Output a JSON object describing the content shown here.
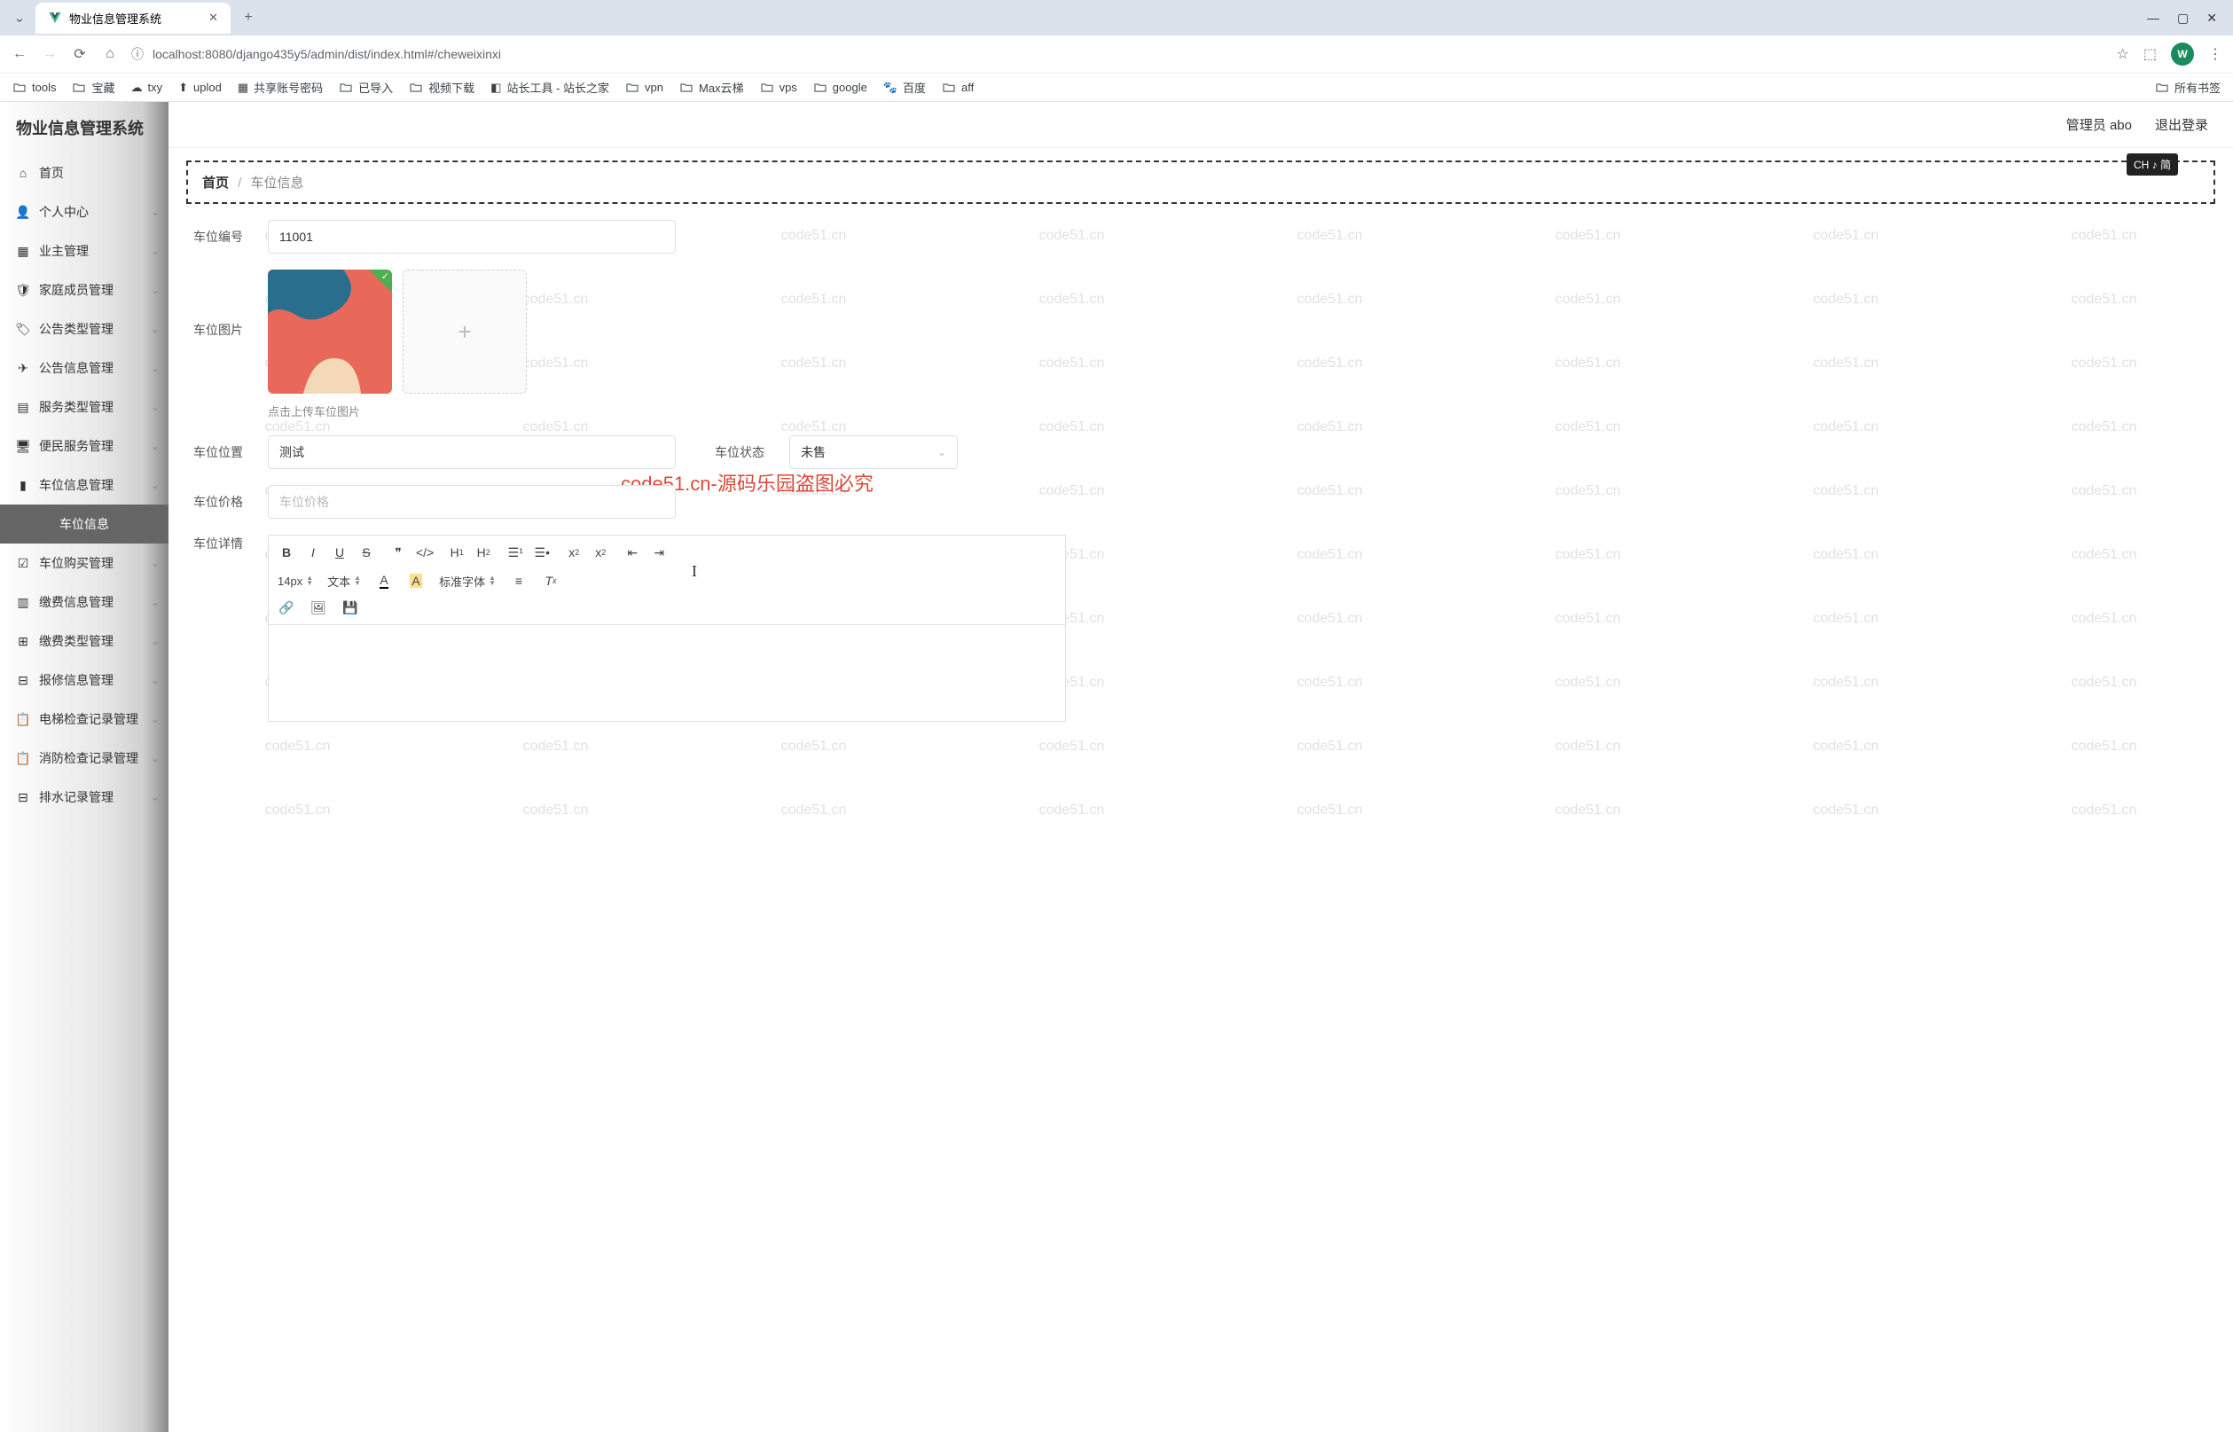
{
  "browser": {
    "tab_title": "物业信息管理系统",
    "url_display": "localhost:8080/django435y5/admin/dist/index.html#/cheweixinxi",
    "bookmarks": [
      "tools",
      "宝藏",
      "txy",
      "uplod",
      "共享账号密码",
      "已导入",
      "视频下载",
      "站长工具 - 站长之家",
      "vpn",
      "Max云梯",
      "vps",
      "google",
      "百度",
      "aff"
    ],
    "all_bookmarks": "所有书签",
    "window_min": "—",
    "window_max": "▢",
    "window_close": "✕",
    "avatar_letter": "W"
  },
  "app_title": "物业信息管理系统",
  "header": {
    "admin": "管理员 abo",
    "logout": "退出登录",
    "ime_badge": "CH ♪ 简"
  },
  "sidebar": {
    "items": [
      {
        "icon": "home",
        "label": "首页",
        "expandable": false
      },
      {
        "icon": "user",
        "label": "个人中心",
        "expandable": true
      },
      {
        "icon": "grid",
        "label": "业主管理",
        "expandable": true
      },
      {
        "icon": "shield",
        "label": "家庭成员管理",
        "expandable": true
      },
      {
        "icon": "tag",
        "label": "公告类型管理",
        "expandable": true
      },
      {
        "icon": "send",
        "label": "公告信息管理",
        "expandable": true
      },
      {
        "icon": "grid2",
        "label": "服务类型管理",
        "expandable": true
      },
      {
        "icon": "monitor",
        "label": "便民服务管理",
        "expandable": true
      },
      {
        "icon": "chart",
        "label": "车位信息管理",
        "expandable": true
      },
      {
        "icon": "",
        "label": "车位信息",
        "expandable": false,
        "active": true
      },
      {
        "icon": "check",
        "label": "车位购买管理",
        "expandable": true
      },
      {
        "icon": "columns",
        "label": "缴费信息管理",
        "expandable": true
      },
      {
        "icon": "module",
        "label": "缴费类型管理",
        "expandable": true
      },
      {
        "icon": "grid3",
        "label": "报修信息管理",
        "expandable": true
      },
      {
        "icon": "clipboard",
        "label": "电梯检查记录管理",
        "expandable": true
      },
      {
        "icon": "clipboard",
        "label": "消防检查记录管理",
        "expandable": true
      },
      {
        "icon": "grid3",
        "label": "排水记录管理",
        "expandable": true
      }
    ]
  },
  "breadcrumb": {
    "root": "首页",
    "current": "车位信息"
  },
  "form": {
    "number_label": "车位编号",
    "number_value": "11001",
    "image_label": "车位图片",
    "upload_caption": "点击上传车位图片",
    "location_label": "车位位置",
    "location_value": "测试",
    "status_label": "车位状态",
    "status_value": "未售",
    "price_label": "车位价格",
    "price_placeholder": "车位价格",
    "detail_label": "车位详情"
  },
  "editor": {
    "font_size": "14px",
    "text_style": "文本",
    "font_family": "标准字体"
  },
  "watermarks": {
    "grey": "code51.cn",
    "red": "code51.cn-源码乐园盗图必究"
  }
}
